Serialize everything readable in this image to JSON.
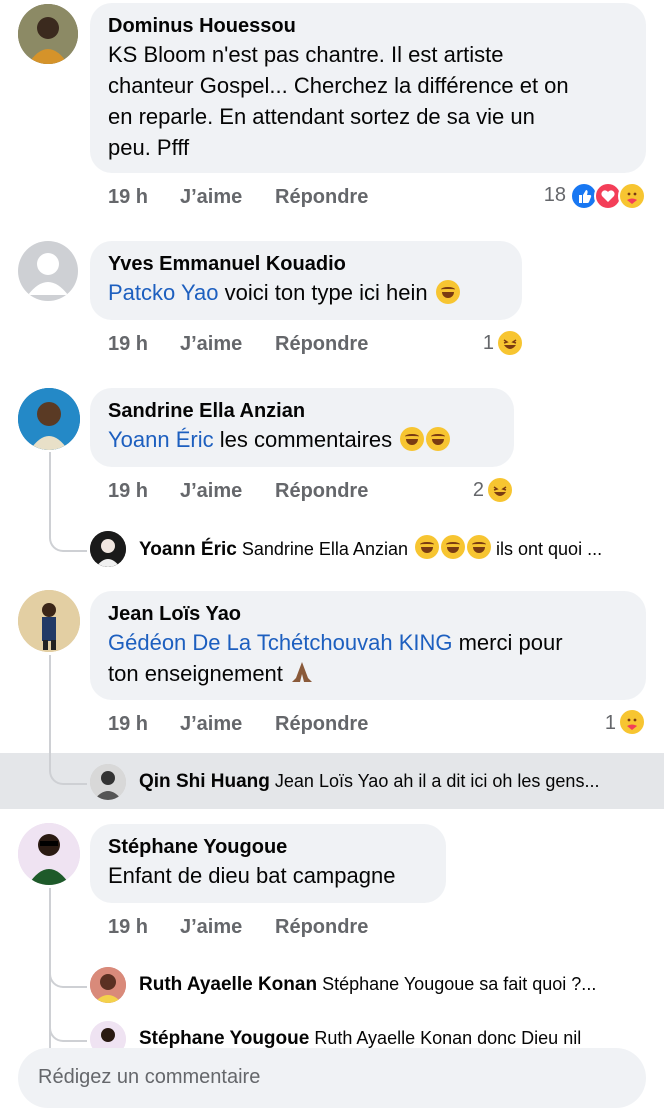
{
  "comments": [
    {
      "author": "Dominus Houessou",
      "lines": [
        "KS Bloom n'est pas chantre. Il est artiste",
        "chanteur Gospel... Cherchez la différence et on",
        "en reparle. En attendant sortez de sa vie un",
        "peu. Pfff"
      ],
      "time": "19 h",
      "like_label": "J’aime",
      "reply_label": "Répondre",
      "reaction_count": "18",
      "reactions": [
        "like-icon",
        "love-icon",
        "care-icon"
      ]
    },
    {
      "author": "Yves Emmanuel Kouadio",
      "mention": "Patcko Yao",
      "text": "voici ton type ici hein",
      "time": "19 h",
      "like_label": "J’aime",
      "reply_label": "Répondre",
      "reaction_count": "1",
      "reactions": [
        "haha-icon"
      ]
    },
    {
      "author": "Sandrine Ella Anzian",
      "mention": "Yoann Éric",
      "text": "les commentaires",
      "time": "19 h",
      "like_label": "J’aime",
      "reply_label": "Répondre",
      "reaction_count": "2",
      "reactions": [
        "haha-icon"
      ],
      "reply": {
        "author": "Yoann Éric",
        "text": "Sandrine Ella Anzian",
        "suffix": "ils ont quoi ..."
      }
    },
    {
      "author": "Jean Loïs Yao",
      "mention": "Gédéon De La Tchétchouvah KING",
      "text": "merci pour",
      "line2": "ton enseignement",
      "time": "19 h",
      "like_label": "J’aime",
      "reply_label": "Répondre",
      "reaction_count": "1",
      "reactions": [
        "care-icon"
      ],
      "reply": {
        "author": "Qin Shi Huang",
        "text": "Jean Loïs Yao ah il a dit ici oh les gens..."
      }
    },
    {
      "author": "Stéphane Yougoue",
      "text": "Enfant de dieu bat campagne",
      "time": "19 h",
      "like_label": "J’aime",
      "reply_label": "Répondre",
      "replies": [
        {
          "author": "Ruth Ayaelle Konan",
          "text": "Stéphane Yougoue sa fait quoi ?..."
        },
        {
          "author": "Stéphane Yougoue",
          "text": "Ruth Ayaelle Konan donc Dieu nil"
        }
      ]
    }
  ],
  "composer": {
    "placeholder": "Rédigez un commentaire"
  },
  "colors": {
    "bubble": "#f0f2f5",
    "mention": "#1d5fbf",
    "meta": "#65676b",
    "like": "#1877f2",
    "love": "#f33e58",
    "haha": "#f7c531"
  }
}
